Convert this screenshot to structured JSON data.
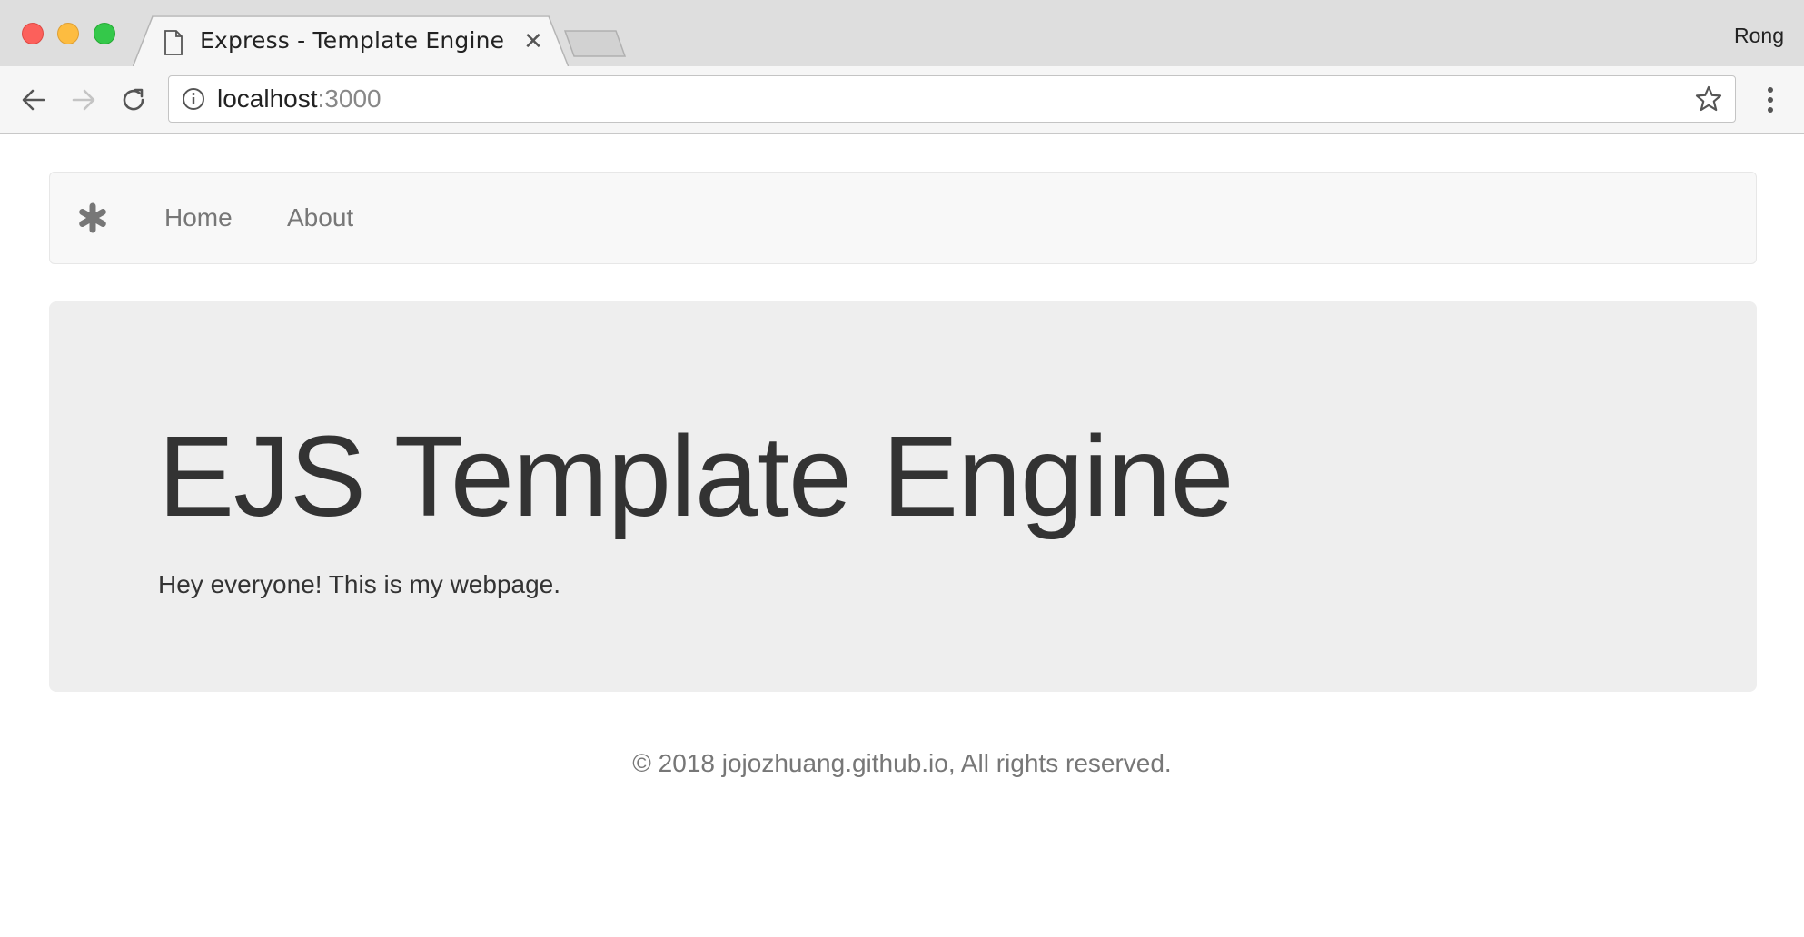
{
  "browser": {
    "tab": {
      "title": "Express - Template Engine"
    },
    "profile_name": "Rong",
    "url": {
      "host": "localhost",
      "port": ":3000"
    }
  },
  "navbar": {
    "brand_icon": "asterisk-icon",
    "links": [
      {
        "label": "Home"
      },
      {
        "label": "About"
      }
    ]
  },
  "jumbotron": {
    "title": "EJS Template Engine",
    "text": "Hey everyone! This is my webpage."
  },
  "footer": {
    "text": "© 2018 jojozhuang.github.io, All rights reserved."
  },
  "colors": {
    "chrome_bg": "#dedede",
    "toolbar_bg": "#f6f6f6",
    "navbar_bg": "#f8f8f8",
    "jumbotron_bg": "#eeeeee",
    "text": "#333333",
    "muted_text": "#777777"
  }
}
